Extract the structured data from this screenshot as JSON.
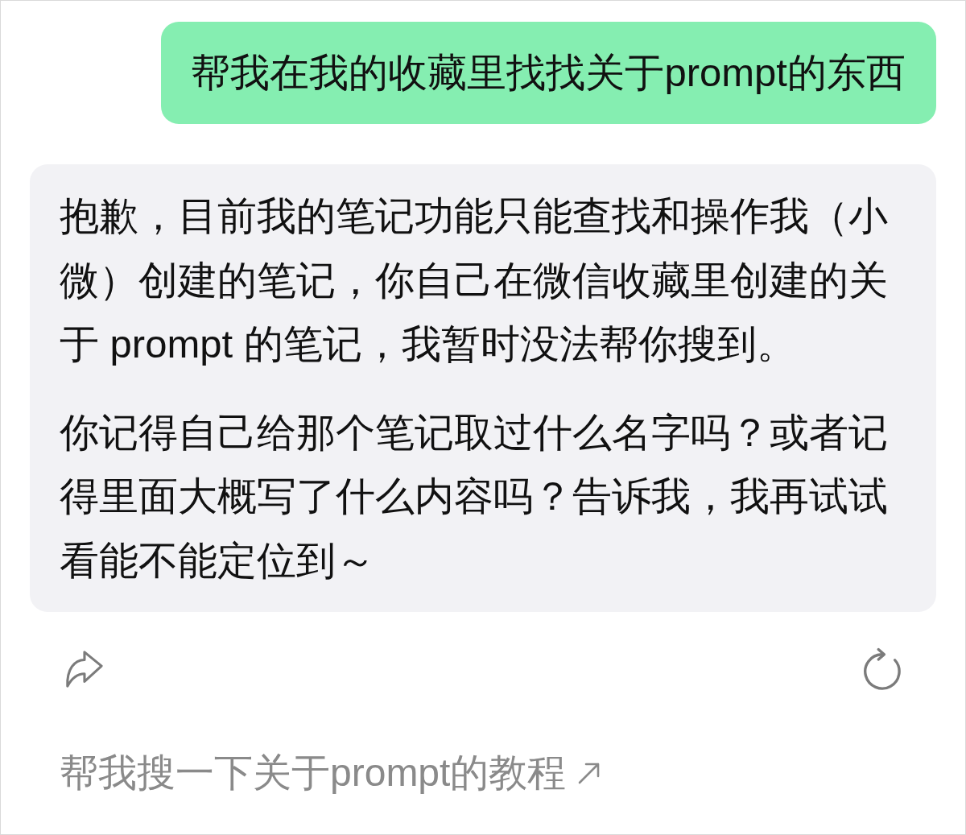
{
  "messages": [
    {
      "kind": "user",
      "text": "帮我在我的收藏里找找关于prompt的东西"
    },
    {
      "kind": "assistant",
      "paragraphs": [
        "抱歉，目前我的笔记功能只能查找和操作我（小微）创建的笔记，你自己在微信收藏里创建的关于 prompt 的笔记，我暂时没法帮你搜到。",
        "你记得自己给那个笔记取过什么名字吗？或者记得里面大概写了什么内容吗？告诉我，我再试试看能不能定位到～"
      ]
    }
  ],
  "actions": [
    {
      "kind": "share"
    },
    {
      "kind": "regenerate"
    }
  ],
  "suggestions": [
    {
      "text": "帮我搜一下关于prompt的教程"
    }
  ]
}
